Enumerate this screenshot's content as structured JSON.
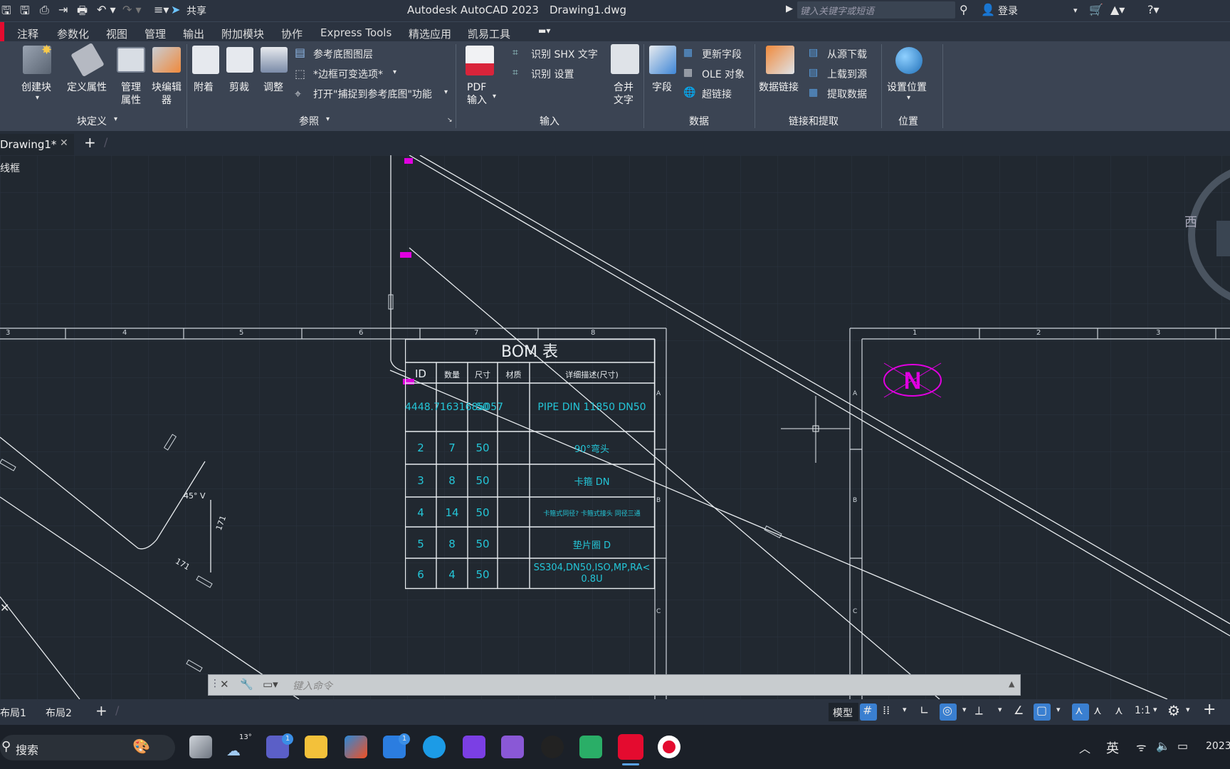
{
  "title": {
    "app": "Autodesk AutoCAD 2023",
    "file": "Drawing1.dwg",
    "share": "共享",
    "search_placeholder": "键入关键字或短语",
    "login": "登录"
  },
  "menu": [
    "注释",
    "参数化",
    "视图",
    "管理",
    "输出",
    "附加模块",
    "协作",
    "Express Tools",
    "精选应用",
    "凯易工具"
  ],
  "ribbon": {
    "block": {
      "create": "创建块",
      "attr": "定义属性",
      "manage": "管理属性",
      "editor": "块编辑器",
      "title": "块定义"
    },
    "ref": {
      "attach": "附着",
      "clip": "剪裁",
      "adjust": "调整",
      "underlay": "参考底图图层",
      "frame": "*边框可变选项*",
      "snap": "打开\"捕捉到参考底图\"功能",
      "title": "参照"
    },
    "import": {
      "pdf": "PDF",
      "pdf2": "输入",
      "shx": "识别 SHX 文字",
      "setting": "识别 设置",
      "merge": "合并",
      "merge2": "文字",
      "title": "输入"
    },
    "data": {
      "field": "字段",
      "update": "更新字段",
      "ole": "OLE 对象",
      "hyper": "超链接",
      "title": "数据"
    },
    "link": {
      "dlink": "数据链接",
      "download": "从源下载",
      "upload": "上载到源",
      "extract": "提取数据",
      "title": "链接和提取"
    },
    "loc": {
      "set": "设置位置",
      "title": "位置"
    }
  },
  "tabs": {
    "active": "Drawing1*"
  },
  "viewport": {
    "label": "线框",
    "compass": "西"
  },
  "bom": {
    "title": "BOM 表",
    "headers": [
      "ID",
      "数量",
      "尺寸",
      "材质",
      "详细描述(尺寸)"
    ],
    "rows": [
      [
        "4448.71631685057",
        "",
        "50",
        "",
        "PIPE DIN 11850 DN50"
      ],
      [
        "2",
        "7",
        "50",
        "",
        "90°弯头"
      ],
      [
        "3",
        "8",
        "50",
        "",
        "卡箍 DN"
      ],
      [
        "4",
        "14",
        "50",
        "",
        "卡箍式同径? 卡箍式接头 同径三通"
      ],
      [
        "5",
        "8",
        "50",
        "",
        "垫片圈 D"
      ],
      [
        "6",
        "4",
        "50",
        "",
        "SS304,DN50,ISO,MP,RA<0.8U"
      ]
    ]
  },
  "grid_top_left": [
    "3",
    "4",
    "5",
    "6",
    "7",
    "8"
  ],
  "grid_top_right": [
    "1",
    "2",
    "3"
  ],
  "grid_side": [
    "A",
    "B",
    "C"
  ],
  "annot": {
    "angle": "45° V",
    "dim1": "171",
    "dim2": "171"
  },
  "command": {
    "placeholder": "键入命令"
  },
  "layouts": [
    "布局1",
    "布局2"
  ],
  "status": {
    "model": "模型",
    "scale": "1:1"
  },
  "taskbar": {
    "search": "搜索",
    "weather": "13°",
    "badge": "1",
    "ime": "英",
    "year": "2023"
  },
  "colors": {
    "accent": "#e40b2f",
    "magenta": "#e000e0",
    "cyan": "#24c6d8"
  }
}
